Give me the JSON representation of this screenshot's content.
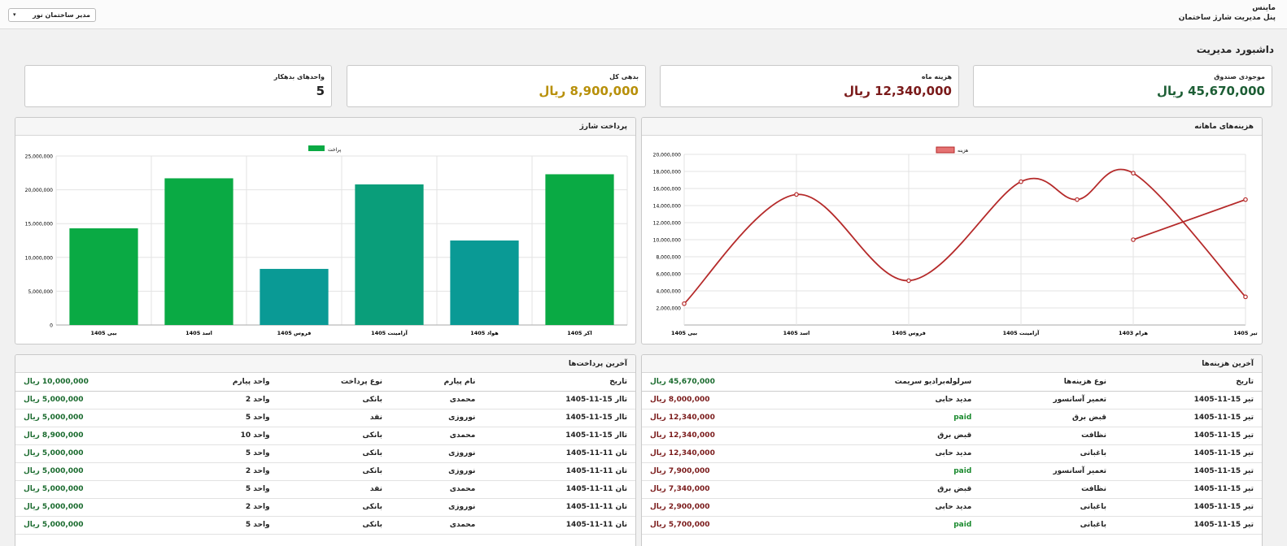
{
  "header": {
    "brand": "ماینس",
    "subtitle": "پنل مدیریت شارژ ساختمان",
    "user_select": "مدیر ساختمان نور"
  },
  "page_title": "داشبورد مدیریت",
  "cards": [
    {
      "label": "موجودی صندوق",
      "value": "45,670,000 ریال",
      "color": "#1d5e35"
    },
    {
      "label": "هزینه ماه",
      "value": "12,340,000 ریال",
      "color": "#7a1a1a"
    },
    {
      "label": "بدهی کل",
      "value": "8,900,000 ریال",
      "color": "#b8900a"
    },
    {
      "label": "واحدهای بدهکار",
      "value": "5",
      "color": "#222222"
    }
  ],
  "expenses_chart": {
    "title": "هزینه‌های ماهانه",
    "legend": "هزینه",
    "color": "#b52a2a",
    "chart_data": {
      "type": "line",
      "x": [
        "تیر 1405",
        "هرام 1403",
        "آزامینت 1405",
        "فروس 1405",
        "اسد 1405",
        "بیی 1405"
      ],
      "values": [
        3300000,
        17800000,
        14700000,
        16800000,
        5200000,
        15300000,
        2500000,
        10000000,
        14700000
      ],
      "ylim": [
        0,
        20000000
      ],
      "yticks": [
        "20,000,000",
        "18,000,000",
        "16,000,000",
        "14,000,000",
        "12,000,000",
        "10,000,000",
        "8,000,000",
        "6,000,000",
        "4,000,000",
        "2,000,000"
      ]
    }
  },
  "payments_chart": {
    "title": "پرداخت شارژ",
    "legend": "پراخت",
    "chart_data": {
      "type": "bar",
      "categories": [
        "اکر 1405",
        "هواذ 1405",
        "آزامینت 1405",
        "فروس 1405",
        "اسد 1405",
        "بیی 1405"
      ],
      "values": [
        22300000,
        12500000,
        20800000,
        8300000,
        21700000,
        14300000
      ],
      "colors": [
        "#0aaa44",
        "#0a9a95",
        "#0a9e7a",
        "#0a9a95",
        "#0aaa44",
        "#0aaa44"
      ],
      "ylim": [
        0,
        25000000
      ],
      "yticks": [
        "25,000,000",
        "20,000,000",
        "15,000,000",
        "10,000,000",
        "5,000,000",
        "0"
      ]
    }
  },
  "expenses_table": {
    "title": "آخرین هزینه‌ها",
    "headers": [
      "تاریخ",
      "نوع هزینه‌ها",
      "سرلوله‌برادیو سریمت",
      "45,670,000 ریال"
    ],
    "rows": [
      [
        "تیر 15-11-1405",
        "تعمیر آسانسور",
        "مدید حابی",
        "8,000,000 ریال"
      ],
      [
        "تیر 15-11-1405",
        "قبض برق",
        "paid",
        "12,340,000 ریال"
      ],
      [
        "تیر 15-11-1405",
        "نظافت",
        "قبض برق",
        "12,340,000 ریال"
      ],
      [
        "تیر 15-11-1405",
        "باغبانی",
        "مدید حابی",
        "12,340,000 ریال"
      ],
      [
        "تیر 15-11-1405",
        "تعمیر آسانسور",
        "paid",
        "7,900,000 ریال"
      ],
      [
        "تیر 15-11-1405",
        "نظافت",
        "قبض برق",
        "7,340,000 ریال"
      ],
      [
        "تیر 15-11-1405",
        "باغبانی",
        "مدید حابی",
        "2,900,000 ریال"
      ],
      [
        "تیر 15-11-1405",
        "باغبانی",
        "paid",
        "5,700,000 ریال"
      ]
    ]
  },
  "payments_table": {
    "title": "آخرین پرداخت‌ها",
    "headers": [
      "تاریخ",
      "نام پیارم",
      "نوع پرداخت",
      "واحد پیارم",
      "10,000,000 ریال"
    ],
    "rows": [
      [
        "تاار 15-11-1405",
        "محمدی",
        "بانکی",
        "واحد 2",
        "5,000,000 ریال"
      ],
      [
        "تاار 15-11-1405",
        "نوروزی",
        "نقد",
        "واحد 5",
        "5,000,000 ریال"
      ],
      [
        "تاار 15-11-1405",
        "محمدی",
        "بانکی",
        "واحد 10",
        "8,900,000 ریال"
      ],
      [
        "تان 11-11-1405",
        "نوروزی",
        "بانکی",
        "واحد 5",
        "5,000,000 ریال"
      ],
      [
        "تان 11-11-1405",
        "نوروزی",
        "بانکی",
        "واحد 2",
        "5,000,000 ریال"
      ],
      [
        "تان 11-11-1405",
        "محمدی",
        "نقد",
        "واحد 5",
        "5,000,000 ریال"
      ],
      [
        "تان 11-11-1405",
        "نوروزی",
        "بانکی",
        "واحد 2",
        "5,000,000 ریال"
      ],
      [
        "نان 11-11-1405",
        "محمدی",
        "بانکی",
        "واحد 5",
        "5,000,000 ریال"
      ]
    ]
  }
}
